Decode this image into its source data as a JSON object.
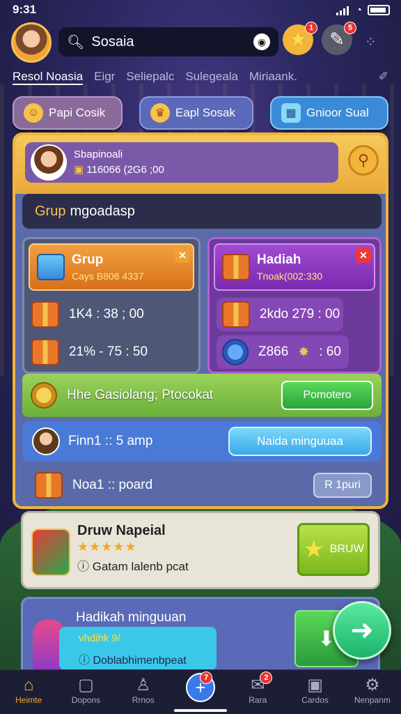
{
  "status": {
    "time": "9:31"
  },
  "header": {
    "search_value": "Sosaia",
    "notif_badge": "1",
    "chat_badge": "5"
  },
  "tabs": [
    "Resol Noasia",
    "Eigr",
    "Seliepalc",
    "Sulegeala",
    "Miriaank."
  ],
  "pills": [
    {
      "label": "Papi Cosik",
      "icon": "smile-icon",
      "color": "#8a6a9a"
    },
    {
      "label": "Eapl Sosak",
      "icon": "crown-icon",
      "color": "#5a6ab8"
    },
    {
      "label": "Gnioor Sual",
      "icon": "box-icon",
      "color": "#3a8ad8"
    }
  ],
  "profile": {
    "name": "Sbapinoali",
    "balance": "116066 (2G6 ;00"
  },
  "group_bar": {
    "prefix": "Grup",
    "text": "mgoadasp"
  },
  "left_box": {
    "title": "Grup",
    "subtitle": "Cays B806 4337",
    "row1": "1K4 : 38 ; 00",
    "row2": "21% - 75 : 50"
  },
  "right_box": {
    "title": "Hadiah",
    "subtitle": "Tnoak(002:330",
    "row1": "2kdo 279 : 00",
    "row2": "Z866",
    "row2_suffix": ": 60"
  },
  "promo": {
    "text": "Hhe Gasiolang; Ptocokat",
    "button": "Pomotero"
  },
  "friend": {
    "text": "Finn1 :: 5 amp",
    "button": "Naida minguuaa"
  },
  "nrow": {
    "text": "Noa1 :: poard",
    "button": "R 1puri"
  },
  "draw": {
    "title": "Druw Napeial",
    "stars": "★★★★★",
    "subtitle": "Gatam lalenb pcat",
    "button": "BRUW"
  },
  "reward": {
    "title": "Hadikah minguuan",
    "line1": "vhdihk 9/",
    "line2": "Doblabhimenbpeat"
  },
  "nav": [
    {
      "label": "Heimte",
      "icon": "home-icon",
      "glyph": "⌂"
    },
    {
      "label": "Dopons",
      "icon": "chat-icon",
      "glyph": "▢"
    },
    {
      "label": "Rrnos",
      "icon": "person-icon",
      "glyph": "♙"
    },
    {
      "label": "",
      "icon": "plus-icon",
      "glyph": "+"
    },
    {
      "label": "Rara",
      "icon": "ticket-icon",
      "glyph": "✉"
    },
    {
      "label": "Cardos",
      "icon": "cardbox-icon",
      "glyph": "▣"
    },
    {
      "label": "Nenpanm",
      "icon": "gear-icon",
      "glyph": "⚙"
    }
  ],
  "nav_badges": {
    "plus": "7",
    "ticket": "2"
  }
}
